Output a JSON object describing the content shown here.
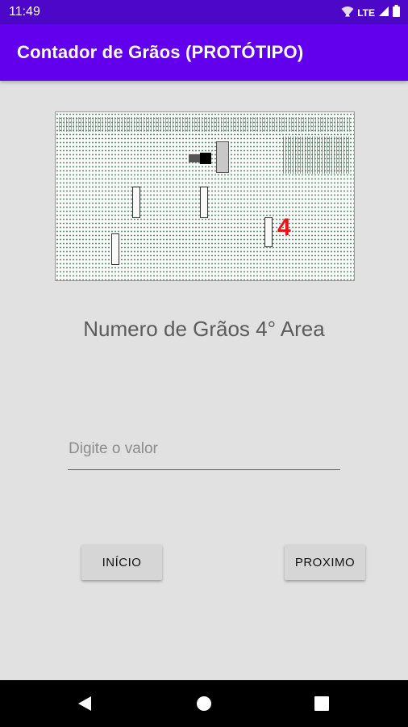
{
  "status_bar": {
    "time": "11:49",
    "network": "LTE",
    "icons": [
      "wifi-icon",
      "signal-icon",
      "battery-icon"
    ]
  },
  "app_bar": {
    "title": "Contador de Grãos (PROTÓTIPO)",
    "color": "#6200ee"
  },
  "map": {
    "area_number": "4",
    "area_number_color": "#e8141a"
  },
  "main": {
    "heading": "Numero de Grãos 4° Area",
    "input": {
      "value": "",
      "placeholder": "Digite o valor"
    }
  },
  "buttons": {
    "inicio": "INÍCIO",
    "proximo": "PROXIMO"
  },
  "nav_bar": {
    "icons": [
      "back-icon",
      "home-icon",
      "recents-icon"
    ]
  }
}
